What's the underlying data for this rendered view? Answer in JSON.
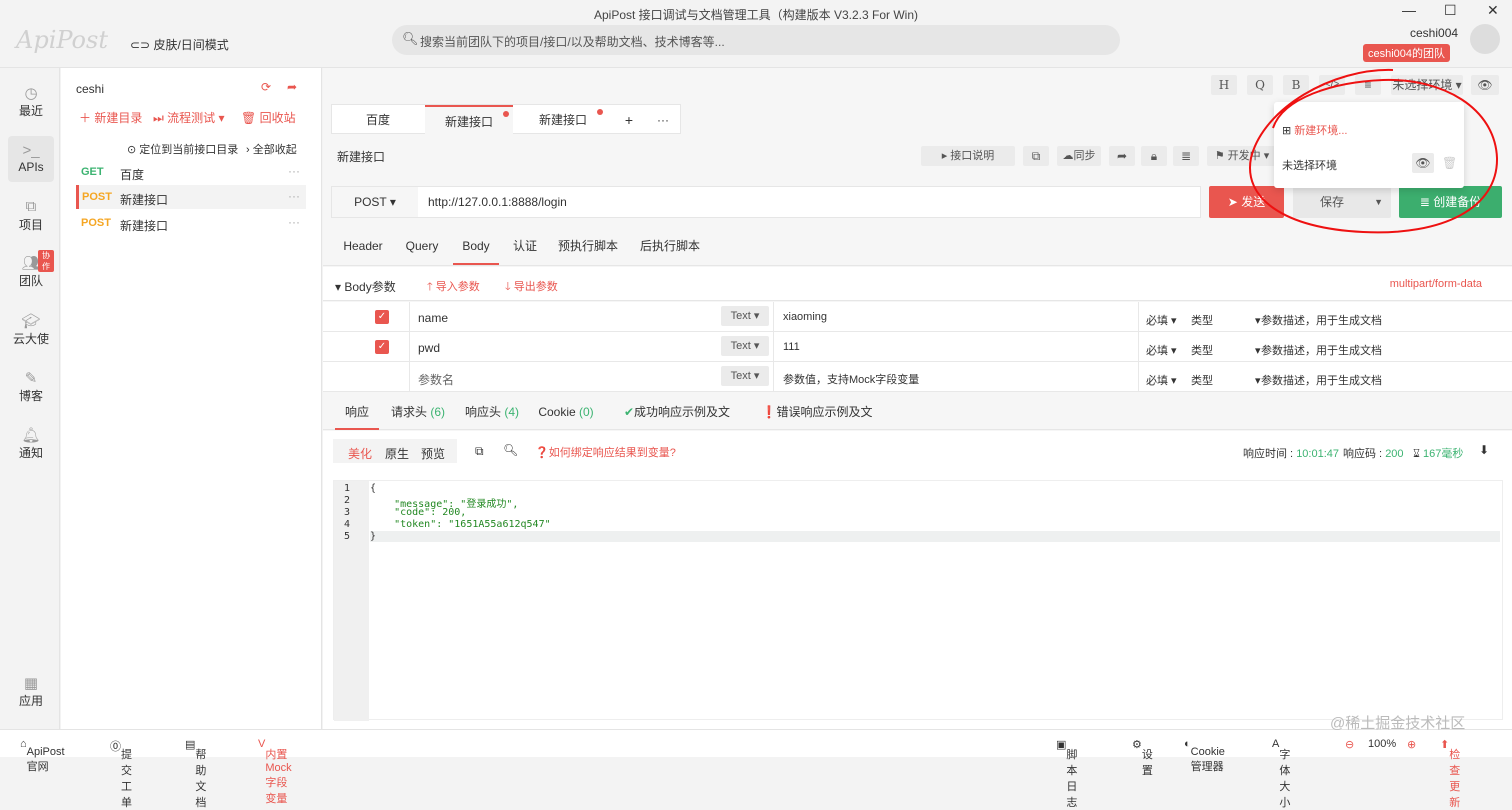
{
  "window": {
    "title": "ApiPost 接口调试与文档管理工具（构建版本 V3.2.3 For Win)",
    "min": "—",
    "max": "☐",
    "close": "✕"
  },
  "header": {
    "logo": "ApiPost",
    "skin": "皮肤/日间模式",
    "search_placeholder": "搜索当前团队下的项目/接口/以及帮助文档、技术博客等...",
    "user": "ceshi004",
    "team": "ceshi004的团队"
  },
  "nav": [
    {
      "label": "最近",
      "icon": "clock"
    },
    {
      "label": "APIs",
      "icon": "terminal"
    },
    {
      "label": "项目",
      "icon": "projects"
    },
    {
      "label": "团队",
      "icon": "team",
      "badge": "协作"
    },
    {
      "label": "云大使",
      "icon": "graduation"
    },
    {
      "label": "博客",
      "icon": "edit"
    },
    {
      "label": "通知",
      "icon": "bell"
    },
    {
      "label": "应用",
      "icon": "apps"
    }
  ],
  "tree": {
    "project": "ceshi",
    "new_dir": "新建目录",
    "flow_test": "流程测试",
    "recycle": "回收站",
    "locate": "定位到当前接口目录",
    "collapse": "全部收起",
    "items": [
      {
        "method": "GET",
        "name": "百度"
      },
      {
        "method": "POST",
        "name": "新建接口"
      },
      {
        "method": "POST",
        "name": "新建接口"
      }
    ]
  },
  "toolbar": {
    "h": "H",
    "q": "Q",
    "b": "B",
    "code": "</>",
    "env": "未选择环境"
  },
  "tabs": [
    {
      "label": "百度"
    },
    {
      "label": "新建接口"
    },
    {
      "label": "新建接口"
    }
  ],
  "api": {
    "name": "新建接口",
    "doc": "接口说明",
    "sync": "同步",
    "status": "开发中",
    "method": "POST",
    "url": "http://127.0.0.1:8888/login",
    "send": "发送",
    "save": "保存",
    "backup": "创建备份"
  },
  "env_dropdown": {
    "new": "新建环境...",
    "item": "未选择环境"
  },
  "req_tabs": [
    "Header",
    "Query",
    "Body",
    "认证",
    "预执行脚本",
    "后执行脚本"
  ],
  "body": {
    "title": "Body参数",
    "import": "导入参数",
    "export": "导出参数",
    "type": "multipart/form-data",
    "rows": [
      {
        "key": "name",
        "type": "Text",
        "value": "xiaoming",
        "req": "必填",
        "vtype": "类型",
        "desc": "参数描述，用于生成文档"
      },
      {
        "key": "pwd",
        "type": "Text",
        "value": "111",
        "req": "必填",
        "vtype": "类型",
        "desc": "参数描述，用于生成文档"
      },
      {
        "key": "参数名",
        "type": "Text",
        "value": "参数值，支持Mock字段变量",
        "req": "必填",
        "vtype": "类型",
        "desc": "参数描述，用于生成文档"
      }
    ]
  },
  "resp_tabs": {
    "resp": "响应",
    "req_headers": "请求头",
    "req_count": "(6)",
    "resp_headers": "响应头",
    "resp_count": "(4)",
    "cookie": "Cookie",
    "cookie_count": "(0)",
    "ok_doc": "成功响应示例及文档",
    "err_doc": "错误响应示例及文档"
  },
  "resp": {
    "beautify": "美化",
    "raw": "原生",
    "preview": "预览",
    "bind": "如何绑定响应结果到变量?",
    "time_label": "响应时间 :",
    "time": "10:01:47",
    "code_label": "响应码 :",
    "code": "200",
    "duration": "167毫秒"
  },
  "code_lines": [
    "{",
    "    \"message\": \"登录成功\",",
    "    \"code\": 200,",
    "    \"token\": \"1651A55a612q547\"",
    "}"
  ],
  "status": {
    "site": "ApiPost官网",
    "ticket": "提交工单",
    "help": "帮助文档",
    "mock": "内置Mock字段变量",
    "log": "脚本日志",
    "settings": "设置",
    "cookie": "Cookie管理器",
    "font": "字体大小",
    "zoom": "100%",
    "update": "检查更新",
    "watermark": "@稀土掘金技术社区"
  }
}
